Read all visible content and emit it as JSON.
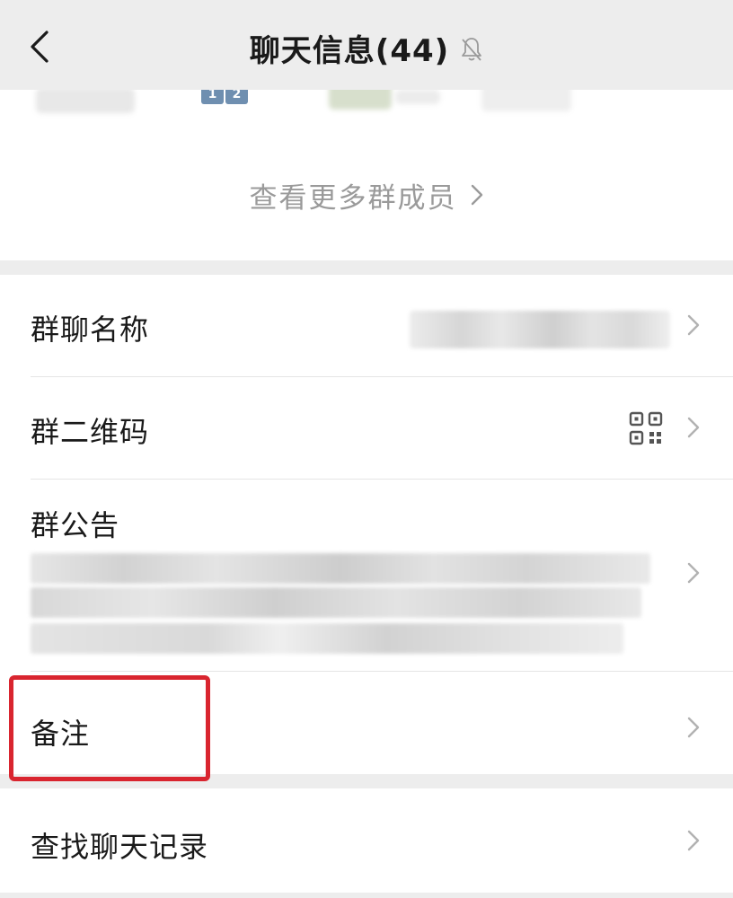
{
  "header": {
    "title": "聊天信息(44)",
    "back_icon": "chevron-left-icon",
    "mute_icon": "bell-muted-icon"
  },
  "members": {
    "badges": [
      "1",
      "2"
    ],
    "view_more_label": "查看更多群成员",
    "view_more_icon": "chevron-right-icon"
  },
  "settings": {
    "group_name_label": "群聊名称",
    "qr_code_label": "群二维码",
    "qr_icon": "qr-code-icon",
    "notice_label": "群公告",
    "remark_label": "备注",
    "search_history_label": "查找聊天记录"
  },
  "colors": {
    "background": "#ededed",
    "card": "#ffffff",
    "text": "#1a1a1a",
    "muted_text": "#9a9a9a",
    "highlight": "#d9252f",
    "badge": "#6f8fb0"
  }
}
